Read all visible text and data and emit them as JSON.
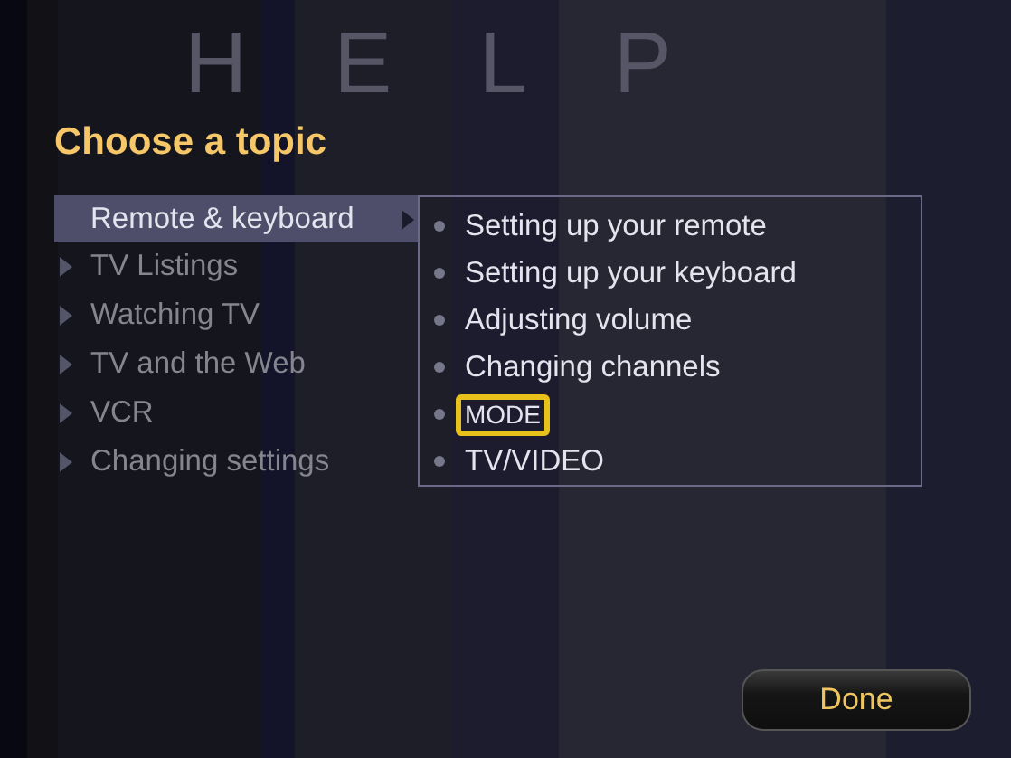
{
  "header": {
    "watermark_letters": [
      "H",
      "E",
      "L",
      "P"
    ],
    "title": "Choose a topic"
  },
  "topics": [
    {
      "label": "Remote & keyboard",
      "selected": true
    },
    {
      "label": "TV Listings",
      "selected": false
    },
    {
      "label": "Watching TV",
      "selected": false
    },
    {
      "label": "TV and the Web",
      "selected": false
    },
    {
      "label": "VCR",
      "selected": false
    },
    {
      "label": "Changing settings",
      "selected": false
    }
  ],
  "subtopics": [
    {
      "label": "Setting up your remote",
      "selected": false
    },
    {
      "label": "Setting up your keyboard",
      "selected": false
    },
    {
      "label": "Adjusting volume",
      "selected": false
    },
    {
      "label": "Changing channels",
      "selected": false
    },
    {
      "label": "MODE",
      "selected": true
    },
    {
      "label": "TV/VIDEO",
      "selected": false
    }
  ],
  "done_button": {
    "label": "Done"
  }
}
